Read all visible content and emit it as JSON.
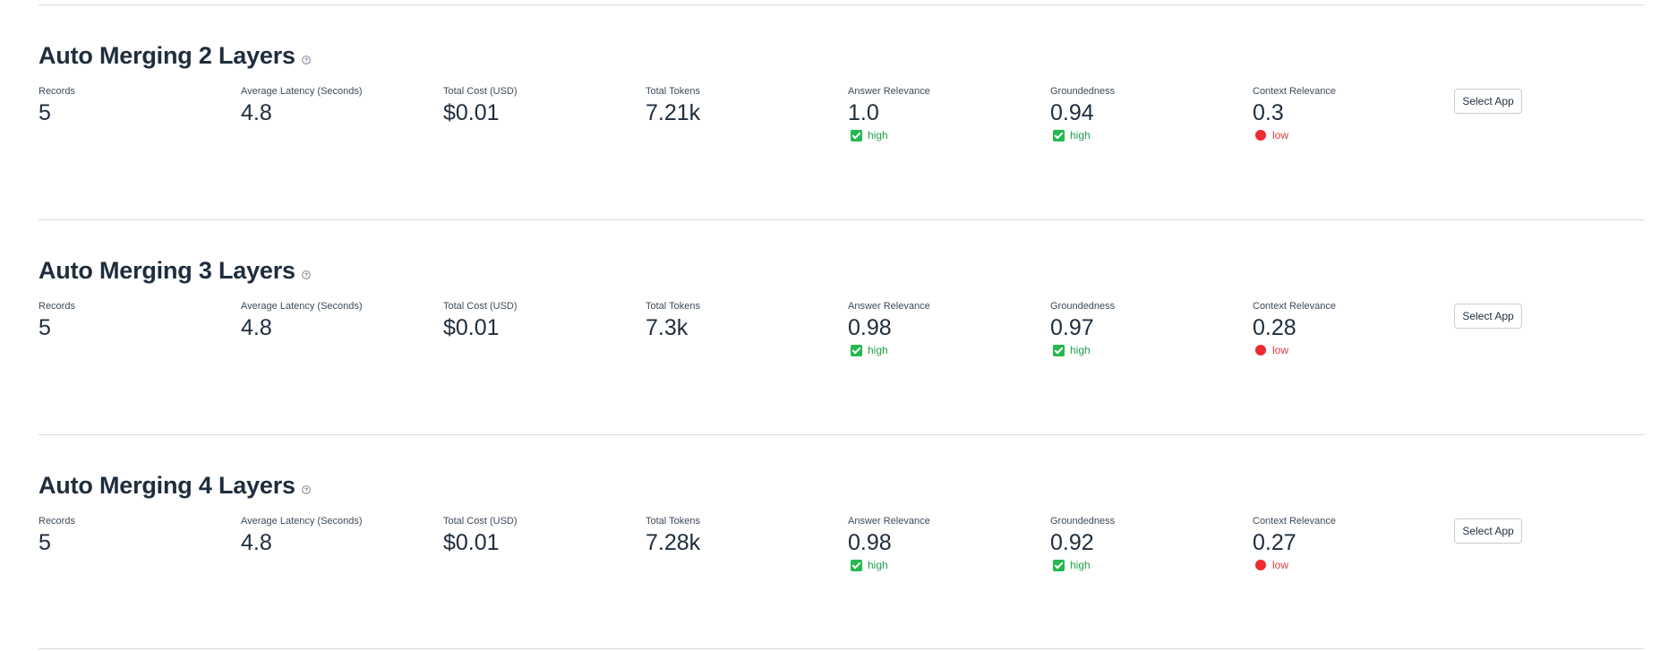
{
  "apps": [
    {
      "title": "Auto Merging 2 Layers",
      "metrics": [
        {
          "label": "Records",
          "value": "5"
        },
        {
          "label": "Average Latency (Seconds)",
          "value": "4.8"
        },
        {
          "label": "Total Cost (USD)",
          "value": "$0.01"
        },
        {
          "label": "Total Tokens",
          "value": "7.21k"
        },
        {
          "label": "Answer Relevance",
          "value": "1.0",
          "badge": "high"
        },
        {
          "label": "Groundedness",
          "value": "0.94",
          "badge": "high"
        },
        {
          "label": "Context Relevance",
          "value": "0.3",
          "badge": "low"
        }
      ],
      "button": "Select App"
    },
    {
      "title": "Auto Merging 3 Layers",
      "metrics": [
        {
          "label": "Records",
          "value": "5"
        },
        {
          "label": "Average Latency (Seconds)",
          "value": "4.8"
        },
        {
          "label": "Total Cost (USD)",
          "value": "$0.01"
        },
        {
          "label": "Total Tokens",
          "value": "7.3k"
        },
        {
          "label": "Answer Relevance",
          "value": "0.98",
          "badge": "high"
        },
        {
          "label": "Groundedness",
          "value": "0.97",
          "badge": "high"
        },
        {
          "label": "Context Relevance",
          "value": "0.28",
          "badge": "low"
        }
      ],
      "button": "Select App"
    },
    {
      "title": "Auto Merging 4 Layers",
      "metrics": [
        {
          "label": "Records",
          "value": "5"
        },
        {
          "label": "Average Latency (Seconds)",
          "value": "4.8"
        },
        {
          "label": "Total Cost (USD)",
          "value": "$0.01"
        },
        {
          "label": "Total Tokens",
          "value": "7.28k"
        },
        {
          "label": "Answer Relevance",
          "value": "0.98",
          "badge": "high"
        },
        {
          "label": "Groundedness",
          "value": "0.92",
          "badge": "high"
        },
        {
          "label": "Context Relevance",
          "value": "0.27",
          "badge": "low"
        }
      ],
      "button": "Select App"
    }
  ],
  "colors": {
    "text": "#1f2d3d",
    "high": "#21a04c",
    "high_icon": "#25b84f",
    "low": "#e0383e",
    "divider": "#d9dcdf"
  },
  "icons": {
    "help": "help-circle-icon",
    "high": "checkbox-checked-icon",
    "low": "red-dot-icon"
  }
}
